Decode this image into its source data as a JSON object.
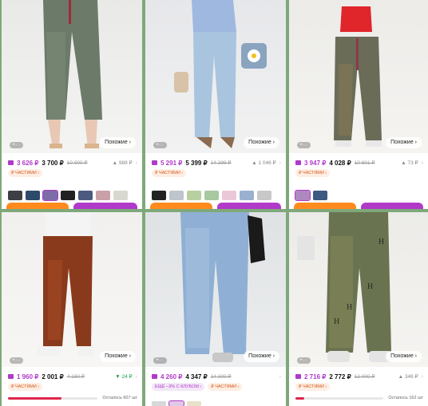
{
  "common": {
    "similar_label": "Похожие ›",
    "dots": "•··"
  },
  "cards": [
    {
      "price_wallet": "3 626 ₽",
      "price": "3 700 ₽",
      "price_old": "10 000 ₽",
      "delta": "▲ 988 ₽",
      "tags": [
        "₽ ЧАСТЯМИ ›"
      ]
    },
    {
      "price_wallet": "5 291 ₽",
      "price": "5 399 ₽",
      "price_old": "14 299 ₽",
      "delta": "▲ 1 046 ₽",
      "tags": [
        "₽ ЧАСТЯМИ ›"
      ]
    },
    {
      "price_wallet": "3 947 ₽",
      "price": "4 028 ₽",
      "price_old": "10 601 ₽",
      "delta": "▲ 73 ₽",
      "tags": [
        "₽ ЧАСТЯМИ ›"
      ]
    },
    {
      "price_wallet": "1 960 ₽",
      "price": "2 001 ₽",
      "price_old": "4 180 ₽",
      "delta": "▼ 24 ₽",
      "tags": [
        "₽ ЧАСТЯМИ ›"
      ],
      "stock_text": "Осталось 607 шт",
      "stock_fill": 0.6
    },
    {
      "price_wallet": "4 260 ₽",
      "price": "4 347 ₽",
      "price_old": "14 300 ₽",
      "delta": "",
      "tags": [
        "ЕЩЁ −3% С КЛУБОМ ›",
        "₽ ЧАСТЯМИ ›"
      ]
    },
    {
      "price_wallet": "2 716 ₽",
      "price": "2 772 ₽",
      "price_old": "12 000 ₽",
      "delta": "▲ 346 ₽",
      "tags": [
        "₽ ЧАСТЯМИ ›"
      ],
      "stock_text": "Осталось 162 шт",
      "stock_fill": 0.1
    }
  ]
}
